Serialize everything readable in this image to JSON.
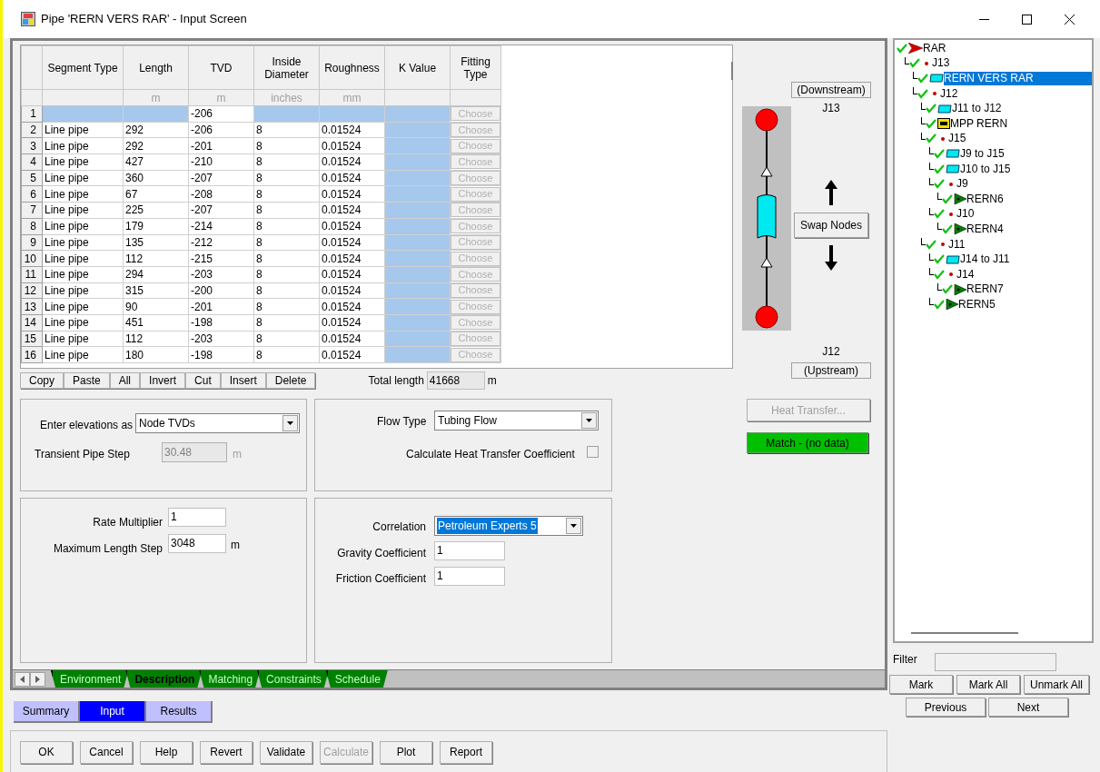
{
  "window": {
    "title": "Pipe 'RERN VERS RAR' - Input Screen"
  },
  "grid": {
    "columns": [
      {
        "label": "Segment Type"
      },
      {
        "label": "Length",
        "unit": "m"
      },
      {
        "label": "TVD",
        "unit": "m"
      },
      {
        "label": "Inside Diameter",
        "unit": "inches"
      },
      {
        "label": "Roughness",
        "unit": "mm"
      },
      {
        "label": "K Value"
      },
      {
        "label": "Fitting Type"
      }
    ],
    "rows": [
      {
        "number": "1",
        "cells": [
          null,
          null,
          "-206",
          null,
          null,
          null
        ],
        "fitting": "Choose"
      },
      {
        "number": "2",
        "cells": [
          "Line pipe",
          "292",
          "-206",
          "8",
          "0.01524",
          null
        ],
        "fitting": "Choose"
      },
      {
        "number": "3",
        "cells": [
          "Line pipe",
          "292",
          "-201",
          "8",
          "0.01524",
          null
        ],
        "fitting": "Choose"
      },
      {
        "number": "4",
        "cells": [
          "Line pipe",
          "427",
          "-210",
          "8",
          "0.01524",
          null
        ],
        "fitting": "Choose"
      },
      {
        "number": "5",
        "cells": [
          "Line pipe",
          "360",
          "-207",
          "8",
          "0.01524",
          null
        ],
        "fitting": "Choose"
      },
      {
        "number": "6",
        "cells": [
          "Line pipe",
          "67",
          "-208",
          "8",
          "0.01524",
          null
        ],
        "fitting": "Choose"
      },
      {
        "number": "7",
        "cells": [
          "Line pipe",
          "225",
          "-207",
          "8",
          "0.01524",
          null
        ],
        "fitting": "Choose"
      },
      {
        "number": "8",
        "cells": [
          "Line pipe",
          "179",
          "-214",
          "8",
          "0.01524",
          null
        ],
        "fitting": "Choose"
      },
      {
        "number": "9",
        "cells": [
          "Line pipe",
          "135",
          "-212",
          "8",
          "0.01524",
          null
        ],
        "fitting": "Choose"
      },
      {
        "number": "10",
        "cells": [
          "Line pipe",
          "112",
          "-215",
          "8",
          "0.01524",
          null
        ],
        "fitting": "Choose"
      },
      {
        "number": "11",
        "cells": [
          "Line pipe",
          "294",
          "-203",
          "8",
          "0.01524",
          null
        ],
        "fitting": "Choose"
      },
      {
        "number": "12",
        "cells": [
          "Line pipe",
          "315",
          "-200",
          "8",
          "0.01524",
          null
        ],
        "fitting": "Choose"
      },
      {
        "number": "13",
        "cells": [
          "Line pipe",
          "90",
          "-201",
          "8",
          "0.01524",
          null
        ],
        "fitting": "Choose"
      },
      {
        "number": "14",
        "cells": [
          "Line pipe",
          "451",
          "-198",
          "8",
          "0.01524",
          null
        ],
        "fitting": "Choose"
      },
      {
        "number": "15",
        "cells": [
          "Line pipe",
          "112",
          "-203",
          "8",
          "0.01524",
          null
        ],
        "fitting": "Choose"
      },
      {
        "number": "16",
        "cells": [
          "Line pipe",
          "180",
          "-198",
          "8",
          "0.01524",
          null
        ],
        "fitting": "Choose"
      }
    ]
  },
  "grid_toolbar": [
    "Copy",
    "Paste",
    "All",
    "Invert",
    "Cut",
    "Insert",
    "Delete"
  ],
  "total_length": {
    "label": "Total length",
    "value": "41668",
    "unit": "m"
  },
  "elevations": {
    "label": "Enter elevations as",
    "value": "Node TVDs"
  },
  "transient_step": {
    "label": "Transient Pipe Step",
    "value": "30.48",
    "unit": "m",
    "disabled": true
  },
  "flow_type": {
    "label": "Flow Type",
    "value": "Tubing Flow"
  },
  "heat_transfer_coefficient": {
    "label": "Calculate Heat Transfer Coefficient",
    "checked": false
  },
  "rate_multiplier": {
    "label": "Rate Multiplier",
    "value": "1"
  },
  "max_length_step": {
    "label": "Maximum Length Step",
    "value": "3048",
    "unit": "m"
  },
  "correlation": {
    "label": "Correlation",
    "value": "Petroleum Experts 5",
    "focused": true
  },
  "gravity_coefficient": {
    "label": "Gravity Coefficient",
    "value": "1"
  },
  "friction_coefficient": {
    "label": "Friction Coefficient",
    "value": "1"
  },
  "diagram": {
    "downstream_label": "(Downstream)",
    "downstream_node": "J13",
    "upstream_node": "J12",
    "upstream_label": "(Upstream)",
    "swap_button": "Swap Nodes"
  },
  "heat_transfer_button": {
    "label": "Heat Transfer...",
    "disabled": true
  },
  "match_button": {
    "label": "Match - (no data)"
  },
  "page_tabs": [
    {
      "label": "Environment",
      "selected": false
    },
    {
      "label": "Description",
      "selected": true
    },
    {
      "label": "Matching",
      "selected": false
    },
    {
      "label": "Constraints",
      "selected": false
    },
    {
      "label": "Schedule",
      "selected": false
    }
  ],
  "view_tabs": [
    {
      "label": "Summary",
      "selected": false
    },
    {
      "label": "Input",
      "selected": true
    },
    {
      "label": "Results",
      "selected": false
    }
  ],
  "buttons": [
    {
      "label": "OK",
      "disabled": false
    },
    {
      "label": "Cancel",
      "disabled": false
    },
    {
      "label": "Help",
      "disabled": false
    },
    {
      "label": "Revert",
      "disabled": false
    },
    {
      "label": "Validate",
      "disabled": false
    },
    {
      "label": "Calculate",
      "disabled": true
    },
    {
      "label": "Plot",
      "disabled": false
    },
    {
      "label": "Report",
      "disabled": false
    }
  ],
  "tree": [
    {
      "label": "RAR",
      "kind": "sink",
      "selected": false,
      "children": [
        {
          "label": "J13",
          "kind": "joint",
          "selected": false,
          "children": [
            {
              "label": "RERN VERS RAR",
              "kind": "pipe",
              "selected": true
            },
            {
              "label": "J12",
              "kind": "joint",
              "selected": false,
              "children": [
                {
                  "label": "J11 to J12",
                  "kind": "pipe",
                  "selected": false
                },
                {
                  "label": "MPP RERN",
                  "kind": "separator",
                  "selected": false
                },
                {
                  "label": "J15",
                  "kind": "joint",
                  "selected": false,
                  "children": [
                    {
                      "label": "J9 to J15",
                      "kind": "pipe",
                      "selected": false
                    },
                    {
                      "label": "J10 to J15",
                      "kind": "pipe",
                      "selected": false
                    },
                    {
                      "label": "J9",
                      "kind": "joint",
                      "selected": false,
                      "children": [
                        {
                          "label": "RERN6",
                          "kind": "well",
                          "selected": false
                        }
                      ]
                    },
                    {
                      "label": "J10",
                      "kind": "joint",
                      "selected": false,
                      "children": [
                        {
                          "label": "RERN4",
                          "kind": "well",
                          "selected": false
                        }
                      ]
                    }
                  ]
                },
                {
                  "label": "J11",
                  "kind": "joint",
                  "selected": false,
                  "children": [
                    {
                      "label": "J14 to J11",
                      "kind": "pipe",
                      "selected": false
                    },
                    {
                      "label": "J14",
                      "kind": "joint",
                      "selected": false,
                      "children": [
                        {
                          "label": "RERN7",
                          "kind": "well",
                          "selected": false
                        }
                      ]
                    },
                    {
                      "label": "RERN5",
                      "kind": "well",
                      "selected": false
                    }
                  ]
                }
              ]
            }
          ]
        }
      ]
    }
  ],
  "filter": {
    "label": "Filter"
  },
  "mark_buttons": [
    "Mark",
    "Mark All",
    "Unmark All"
  ],
  "nav_buttons": [
    "Previous",
    "Next"
  ]
}
